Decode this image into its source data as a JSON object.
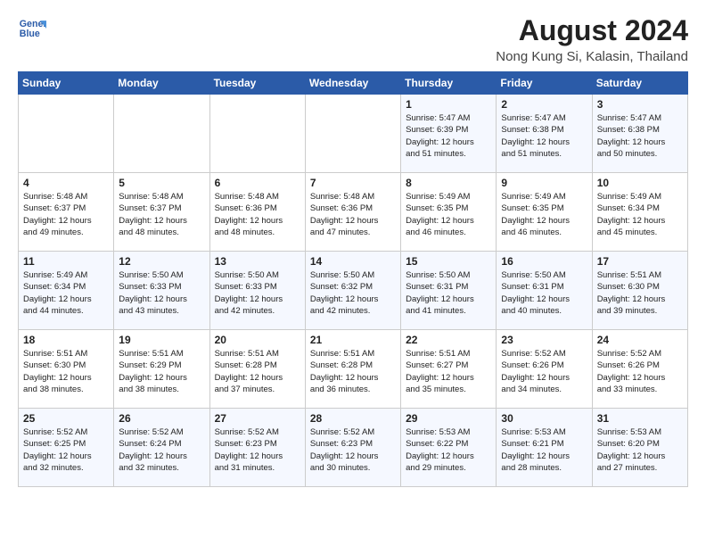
{
  "logo": {
    "line1": "General",
    "line2": "Blue"
  },
  "title": "August 2024",
  "subtitle": "Nong Kung Si, Kalasin, Thailand",
  "days_of_week": [
    "Sunday",
    "Monday",
    "Tuesday",
    "Wednesday",
    "Thursday",
    "Friday",
    "Saturday"
  ],
  "weeks": [
    [
      {
        "day": "",
        "info": ""
      },
      {
        "day": "",
        "info": ""
      },
      {
        "day": "",
        "info": ""
      },
      {
        "day": "",
        "info": ""
      },
      {
        "day": "1",
        "info": "Sunrise: 5:47 AM\nSunset: 6:39 PM\nDaylight: 12 hours\nand 51 minutes."
      },
      {
        "day": "2",
        "info": "Sunrise: 5:47 AM\nSunset: 6:38 PM\nDaylight: 12 hours\nand 51 minutes."
      },
      {
        "day": "3",
        "info": "Sunrise: 5:47 AM\nSunset: 6:38 PM\nDaylight: 12 hours\nand 50 minutes."
      }
    ],
    [
      {
        "day": "4",
        "info": "Sunrise: 5:48 AM\nSunset: 6:37 PM\nDaylight: 12 hours\nand 49 minutes."
      },
      {
        "day": "5",
        "info": "Sunrise: 5:48 AM\nSunset: 6:37 PM\nDaylight: 12 hours\nand 48 minutes."
      },
      {
        "day": "6",
        "info": "Sunrise: 5:48 AM\nSunset: 6:36 PM\nDaylight: 12 hours\nand 48 minutes."
      },
      {
        "day": "7",
        "info": "Sunrise: 5:48 AM\nSunset: 6:36 PM\nDaylight: 12 hours\nand 47 minutes."
      },
      {
        "day": "8",
        "info": "Sunrise: 5:49 AM\nSunset: 6:35 PM\nDaylight: 12 hours\nand 46 minutes."
      },
      {
        "day": "9",
        "info": "Sunrise: 5:49 AM\nSunset: 6:35 PM\nDaylight: 12 hours\nand 46 minutes."
      },
      {
        "day": "10",
        "info": "Sunrise: 5:49 AM\nSunset: 6:34 PM\nDaylight: 12 hours\nand 45 minutes."
      }
    ],
    [
      {
        "day": "11",
        "info": "Sunrise: 5:49 AM\nSunset: 6:34 PM\nDaylight: 12 hours\nand 44 minutes."
      },
      {
        "day": "12",
        "info": "Sunrise: 5:50 AM\nSunset: 6:33 PM\nDaylight: 12 hours\nand 43 minutes."
      },
      {
        "day": "13",
        "info": "Sunrise: 5:50 AM\nSunset: 6:33 PM\nDaylight: 12 hours\nand 42 minutes."
      },
      {
        "day": "14",
        "info": "Sunrise: 5:50 AM\nSunset: 6:32 PM\nDaylight: 12 hours\nand 42 minutes."
      },
      {
        "day": "15",
        "info": "Sunrise: 5:50 AM\nSunset: 6:31 PM\nDaylight: 12 hours\nand 41 minutes."
      },
      {
        "day": "16",
        "info": "Sunrise: 5:50 AM\nSunset: 6:31 PM\nDaylight: 12 hours\nand 40 minutes."
      },
      {
        "day": "17",
        "info": "Sunrise: 5:51 AM\nSunset: 6:30 PM\nDaylight: 12 hours\nand 39 minutes."
      }
    ],
    [
      {
        "day": "18",
        "info": "Sunrise: 5:51 AM\nSunset: 6:30 PM\nDaylight: 12 hours\nand 38 minutes."
      },
      {
        "day": "19",
        "info": "Sunrise: 5:51 AM\nSunset: 6:29 PM\nDaylight: 12 hours\nand 38 minutes."
      },
      {
        "day": "20",
        "info": "Sunrise: 5:51 AM\nSunset: 6:28 PM\nDaylight: 12 hours\nand 37 minutes."
      },
      {
        "day": "21",
        "info": "Sunrise: 5:51 AM\nSunset: 6:28 PM\nDaylight: 12 hours\nand 36 minutes."
      },
      {
        "day": "22",
        "info": "Sunrise: 5:51 AM\nSunset: 6:27 PM\nDaylight: 12 hours\nand 35 minutes."
      },
      {
        "day": "23",
        "info": "Sunrise: 5:52 AM\nSunset: 6:26 PM\nDaylight: 12 hours\nand 34 minutes."
      },
      {
        "day": "24",
        "info": "Sunrise: 5:52 AM\nSunset: 6:26 PM\nDaylight: 12 hours\nand 33 minutes."
      }
    ],
    [
      {
        "day": "25",
        "info": "Sunrise: 5:52 AM\nSunset: 6:25 PM\nDaylight: 12 hours\nand 32 minutes."
      },
      {
        "day": "26",
        "info": "Sunrise: 5:52 AM\nSunset: 6:24 PM\nDaylight: 12 hours\nand 32 minutes."
      },
      {
        "day": "27",
        "info": "Sunrise: 5:52 AM\nSunset: 6:23 PM\nDaylight: 12 hours\nand 31 minutes."
      },
      {
        "day": "28",
        "info": "Sunrise: 5:52 AM\nSunset: 6:23 PM\nDaylight: 12 hours\nand 30 minutes."
      },
      {
        "day": "29",
        "info": "Sunrise: 5:53 AM\nSunset: 6:22 PM\nDaylight: 12 hours\nand 29 minutes."
      },
      {
        "day": "30",
        "info": "Sunrise: 5:53 AM\nSunset: 6:21 PM\nDaylight: 12 hours\nand 28 minutes."
      },
      {
        "day": "31",
        "info": "Sunrise: 5:53 AM\nSunset: 6:20 PM\nDaylight: 12 hours\nand 27 minutes."
      }
    ]
  ]
}
